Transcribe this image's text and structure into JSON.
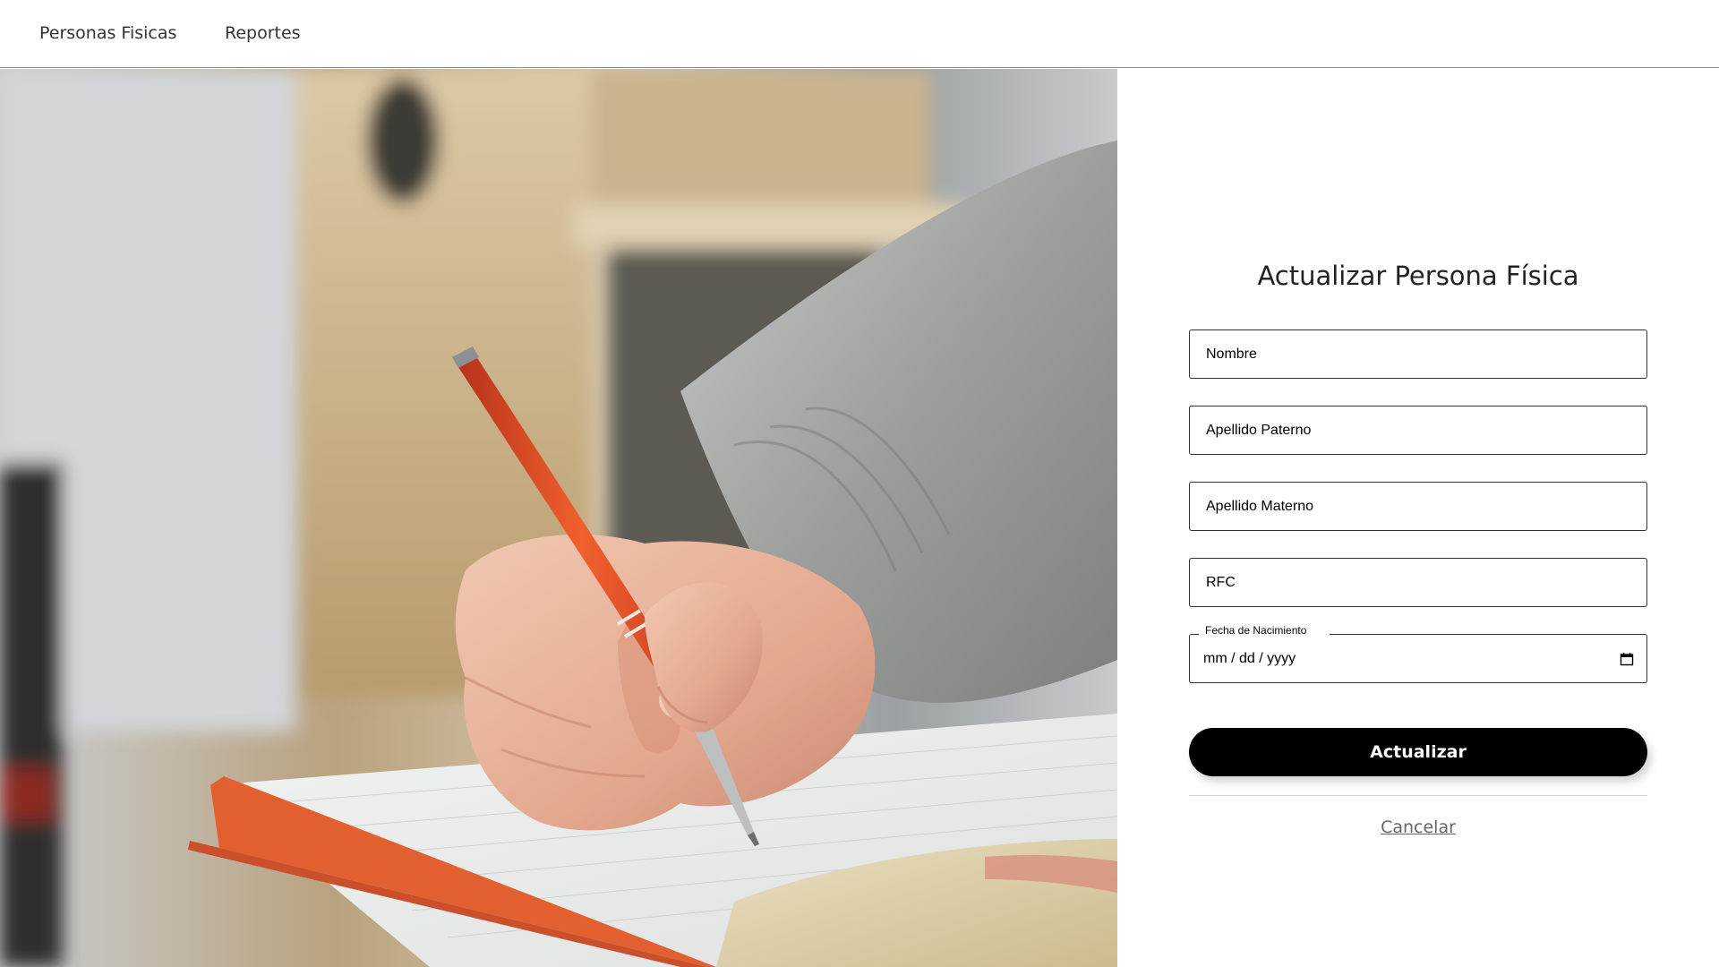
{
  "navbar": {
    "items": [
      {
        "label": "Personas Fisicas"
      },
      {
        "label": "Reportes"
      }
    ]
  },
  "hero": {
    "description": "photo-hand-writing-with-orange-pen-in-notebook"
  },
  "form": {
    "title": "Actualizar Persona Física",
    "fields": [
      {
        "placeholder": "Nombre",
        "value": ""
      },
      {
        "placeholder": "Apellido Paterno",
        "value": ""
      },
      {
        "placeholder": "Apellido Materno",
        "value": ""
      },
      {
        "placeholder": "RFC",
        "value": ""
      }
    ],
    "birthdate": {
      "label": "Fecha de Nacimiento",
      "placeholder": "mm / dd / yyyy",
      "icon": "calendar-icon"
    },
    "submit_label": "Actualizar",
    "cancel_label": "Cancelar"
  },
  "colors": {
    "button_bg": "#000000",
    "button_text": "#ffffff",
    "link": "#666666",
    "pen": "#e8532b",
    "notebook_edge": "#e2602f"
  }
}
